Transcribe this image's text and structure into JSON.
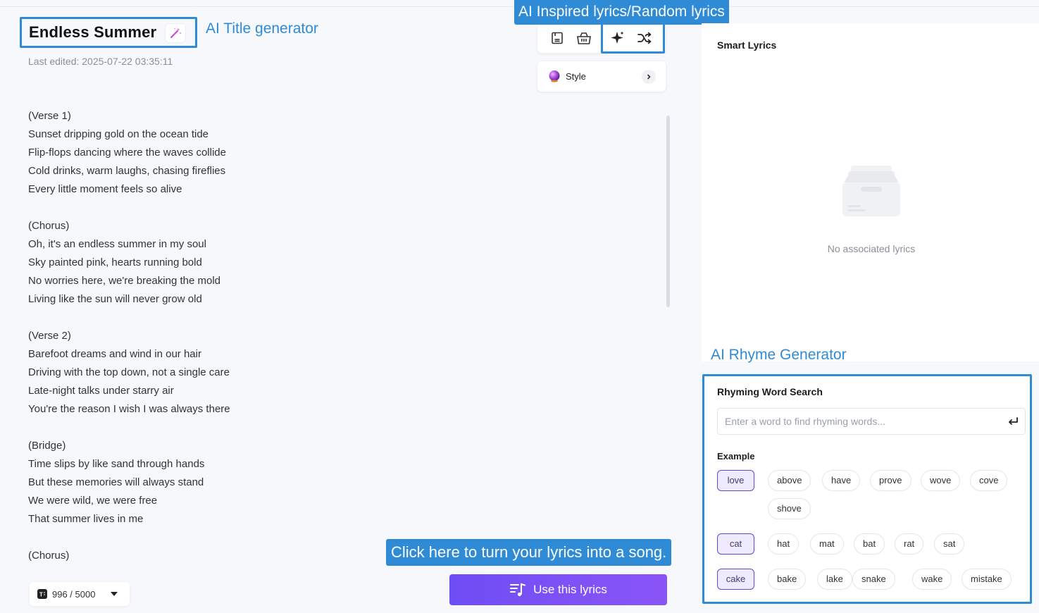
{
  "annotations": {
    "title_generator": "AI Title generator",
    "inspired_random": "AI Inspired lyrics/Random lyrics",
    "rhyme_generator": "AI Rhyme Generator",
    "use_lyrics_hint": "Click here to turn your lyrics into a song."
  },
  "editor": {
    "song_title": "Endless Summer",
    "last_edited": "Last edited: 2025-07-22 03:35:11",
    "lyrics": [
      "(Verse 1)",
      "Sunset dripping gold on the ocean tide",
      "Flip-flops dancing where the waves collide",
      "Cold drinks, warm laughs, chasing fireflies",
      "Every little moment feels so alive",
      "",
      "(Chorus)",
      "Oh, it's an endless summer in my soul",
      "Sky painted pink, hearts running bold",
      "No worries here, we're breaking the mold",
      "Living like the sun will never grow old",
      "",
      "(Verse 2)",
      "Barefoot dreams and wind in our hair",
      "Driving with the top down, not a single care",
      "Late-night talks under starry air",
      "You're the reason I wish I was always there",
      "",
      "(Bridge)",
      "Time slips by like sand through hands",
      "But these memories will always stand",
      "We were wild, we were free",
      "That summer lives in me",
      "",
      "(Chorus)"
    ],
    "char_count": "996 / 5000",
    "use_button": "Use this lyrics"
  },
  "toolbar": {
    "style_label": "Style"
  },
  "smart_lyrics": {
    "title": "Smart Lyrics",
    "empty_text": "No associated lyrics"
  },
  "rhyme": {
    "title": "Rhyming Word Search",
    "placeholder": "Enter a word to find rhyming words...",
    "example_label": "Example",
    "examples": [
      {
        "key": "love",
        "words": [
          "above",
          "have",
          "prove",
          "wove",
          "cove",
          "shove"
        ]
      },
      {
        "key": "cat",
        "words": [
          "hat",
          "mat",
          "bat",
          "rat",
          "sat"
        ]
      },
      {
        "key": "cake",
        "words": [
          "bake",
          "lake",
          "snake",
          "wake",
          "mistake"
        ]
      }
    ]
  },
  "colors": {
    "annotation_blue": "#2f8bd6",
    "primary_purple": "#6f4df5",
    "chip_key_bg": "#efeaff"
  }
}
